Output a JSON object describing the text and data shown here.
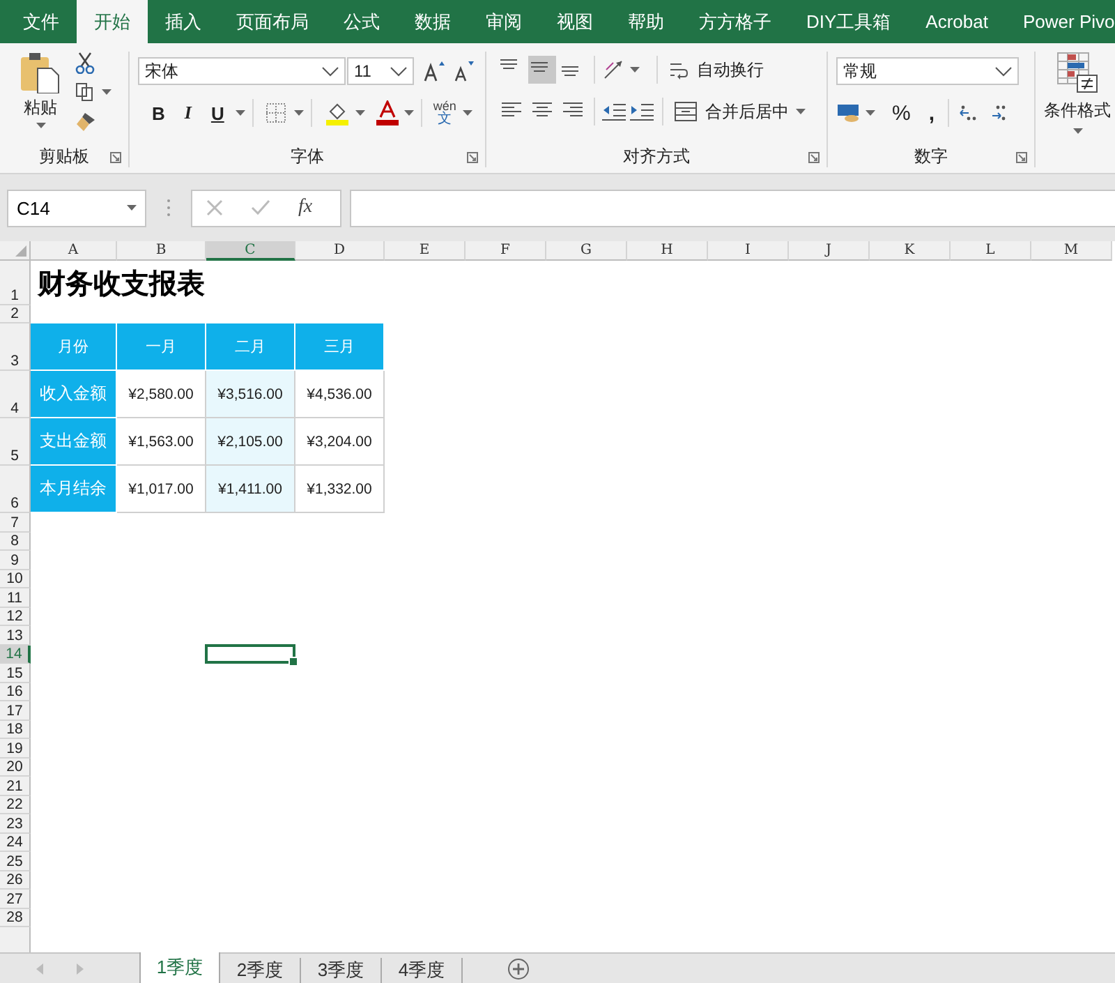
{
  "ribbon_tabs": [
    {
      "label": "文件",
      "selected": false
    },
    {
      "label": "开始",
      "selected": true
    },
    {
      "label": "插入",
      "selected": false
    },
    {
      "label": "页面布局",
      "selected": false
    },
    {
      "label": "公式",
      "selected": false
    },
    {
      "label": "数据",
      "selected": false
    },
    {
      "label": "审阅",
      "selected": false
    },
    {
      "label": "视图",
      "selected": false
    },
    {
      "label": "帮助",
      "selected": false
    },
    {
      "label": "方方格子",
      "selected": false
    },
    {
      "label": "DIY工具箱",
      "selected": false
    },
    {
      "label": "Acrobat",
      "selected": false
    },
    {
      "label": "Power Pivo",
      "selected": false
    }
  ],
  "clipboard": {
    "paste": "粘贴",
    "label": "剪贴板"
  },
  "font": {
    "name": "宋体",
    "size": "11",
    "bold": "B",
    "italic": "I",
    "underline": "U",
    "phonetic_top": "wén",
    "phonetic_bottom": "文",
    "label": "字体"
  },
  "alignment": {
    "vertical": [
      {
        "kind": "top",
        "selected": false
      },
      {
        "kind": "middle",
        "selected": true
      },
      {
        "kind": "bottom",
        "selected": false
      }
    ],
    "wrap": "自动换行",
    "merge": "合并后居中",
    "label": "对齐方式"
  },
  "number": {
    "format": "常规",
    "percent": "%",
    "comma": ",",
    "label": "数字"
  },
  "styles": {
    "conditional": "条件格式"
  },
  "name_box": "C14",
  "function_label": "fx",
  "columns": [
    {
      "label": "A",
      "selected": false
    },
    {
      "label": "B",
      "selected": false
    },
    {
      "label": "C",
      "selected": true
    },
    {
      "label": "D",
      "selected": false
    },
    {
      "label": "E",
      "selected": false
    },
    {
      "label": "F",
      "selected": false
    },
    {
      "label": "G",
      "selected": false
    },
    {
      "label": "H",
      "selected": false
    },
    {
      "label": "I",
      "selected": false
    },
    {
      "label": "J",
      "selected": false
    },
    {
      "label": "K",
      "selected": false
    },
    {
      "label": "L",
      "selected": false
    },
    {
      "label": "M",
      "selected": false
    }
  ],
  "rows": [
    {
      "label": "1",
      "selected": false
    },
    {
      "label": "2",
      "selected": false
    },
    {
      "label": "3",
      "selected": false
    },
    {
      "label": "4",
      "selected": false
    },
    {
      "label": "5",
      "selected": false
    },
    {
      "label": "6",
      "selected": false
    },
    {
      "label": "7",
      "selected": false
    },
    {
      "label": "8",
      "selected": false
    },
    {
      "label": "9",
      "selected": false
    },
    {
      "label": "10",
      "selected": false
    },
    {
      "label": "11",
      "selected": false
    },
    {
      "label": "12",
      "selected": false
    },
    {
      "label": "13",
      "selected": false
    },
    {
      "label": "14",
      "selected": true
    },
    {
      "label": "15",
      "selected": false
    },
    {
      "label": "16",
      "selected": false
    },
    {
      "label": "17",
      "selected": false
    },
    {
      "label": "18",
      "selected": false
    },
    {
      "label": "19",
      "selected": false
    },
    {
      "label": "20",
      "selected": false
    },
    {
      "label": "21",
      "selected": false
    },
    {
      "label": "22",
      "selected": false
    },
    {
      "label": "23",
      "selected": false
    },
    {
      "label": "24",
      "selected": false
    },
    {
      "label": "25",
      "selected": false
    },
    {
      "label": "26",
      "selected": false
    },
    {
      "label": "27",
      "selected": false
    },
    {
      "label": "28",
      "selected": false
    }
  ],
  "sheet_title": "财务收支报表",
  "table": {
    "columns": [
      "月份",
      "一月",
      "二月",
      "三月"
    ],
    "rows": [
      {
        "label": "收入金额",
        "values": [
          {
            "text": "¥2,580.00",
            "highlighted": false
          },
          {
            "text": "¥3,516.00",
            "highlighted": true
          },
          {
            "text": "¥4,536.00",
            "highlighted": false
          }
        ]
      },
      {
        "label": "支出金额",
        "values": [
          {
            "text": "¥1,563.00",
            "highlighted": false
          },
          {
            "text": "¥2,105.00",
            "highlighted": true
          },
          {
            "text": "¥3,204.00",
            "highlighted": false
          }
        ]
      },
      {
        "label": "本月结余",
        "values": [
          {
            "text": "¥1,017.00",
            "highlighted": false
          },
          {
            "text": "¥1,411.00",
            "highlighted": true
          },
          {
            "text": "¥1,332.00",
            "highlighted": false
          }
        ]
      }
    ]
  },
  "sheet_tabs": [
    {
      "label": "1季度",
      "selected": true
    },
    {
      "label": "2季度",
      "selected": false
    },
    {
      "label": "3季度",
      "selected": false
    },
    {
      "label": "4季度",
      "selected": false
    }
  ]
}
